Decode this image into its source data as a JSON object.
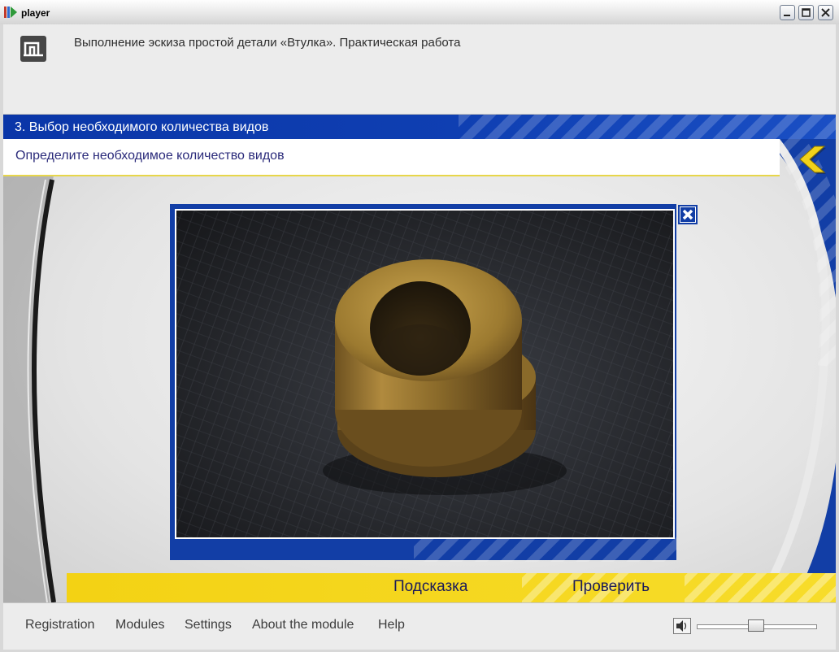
{
  "window": {
    "title": "player"
  },
  "header": {
    "module_title": "Выполнение эскиза простой детали «Втулка». Практическая работа"
  },
  "step": {
    "title": "3. Выбор необходимого количества видов",
    "task": "Определите необходимое количество видов"
  },
  "actions": {
    "hint_label": "Подсказка",
    "check_label": "Проверить"
  },
  "footer": {
    "menu": [
      {
        "label": "Registration"
      },
      {
        "label": "Modules"
      },
      {
        "label": "Settings"
      },
      {
        "label": "About the module"
      },
      {
        "label": "Help"
      }
    ],
    "volume_level": 0.5
  },
  "colors": {
    "brand_blue": "#0f3fb2",
    "accent_yellow": "#f3d214",
    "task_text": "#2a2a7a"
  },
  "icons": {
    "app": "player-app-icon",
    "logo": "module-logo-icon",
    "back": "back-chevron-icon",
    "close": "close-icon",
    "volume": "speaker-icon"
  }
}
